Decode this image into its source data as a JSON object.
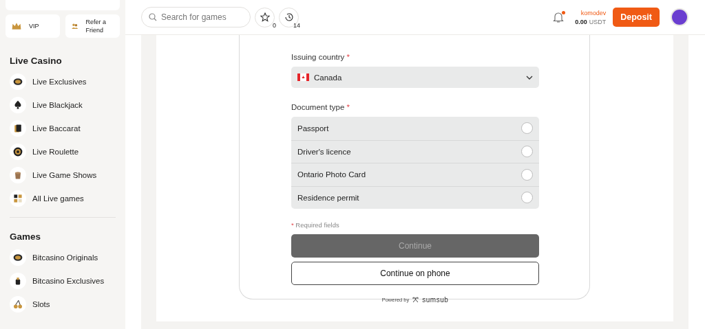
{
  "sidebar": {
    "promo_cards": [
      {
        "label": "VIP",
        "kind": "crown"
      },
      {
        "label": "Refer a Friend",
        "kind": "friend"
      }
    ],
    "sections": [
      {
        "title": "Live Casino",
        "items": [
          {
            "label": "Live Exclusives",
            "kind": "chip"
          },
          {
            "label": "Live Blackjack",
            "kind": "spade"
          },
          {
            "label": "Live Baccarat",
            "kind": "cards"
          },
          {
            "label": "Live Roulette",
            "kind": "roulette"
          },
          {
            "label": "Live Game Shows",
            "kind": "hat"
          },
          {
            "label": "All Live games",
            "kind": "grid"
          }
        ]
      },
      {
        "title": "Games",
        "items": [
          {
            "label": "Bitcasino Originals",
            "kind": "chip"
          },
          {
            "label": "Bitcasino Exclusives",
            "kind": "cup"
          },
          {
            "label": "Slots",
            "kind": "cherry"
          }
        ]
      }
    ]
  },
  "header": {
    "search": {
      "placeholder": "Search for games"
    },
    "favorites_count": "0",
    "recent_count": "14",
    "notification": true,
    "username": "komodev",
    "balance": "0.00",
    "currency": "USDT",
    "deposit": "Deposit"
  },
  "verification": {
    "country_label": "Issuing country",
    "country_required": true,
    "country": "Canada",
    "document_label": "Document type",
    "document_required": true,
    "documents": [
      {
        "label": "Passport",
        "selected": false
      },
      {
        "label": "Driver's licence",
        "selected": false
      },
      {
        "label": "Ontario Photo Card",
        "selected": false
      },
      {
        "label": "Residence permit",
        "selected": false
      }
    ],
    "required_mark": "*",
    "required_note": "Required fields",
    "continue": {
      "label": "Continue",
      "disabled": true
    },
    "continue_phone": "Continue on phone",
    "powered_by": "Powered by",
    "brand": "sumsub"
  }
}
